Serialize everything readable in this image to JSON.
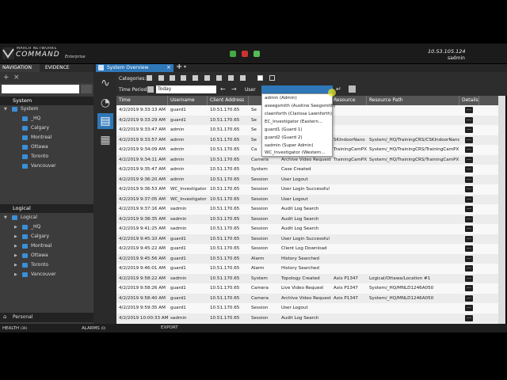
{
  "brand": {
    "line1": "MARCH NETWORKS",
    "line2": "COMMAND",
    "line3": "Enterprise"
  },
  "server": {
    "ip": "10.53.105.124",
    "user": "sadmin"
  },
  "nav": {
    "tabs": [
      "NAVIGATION",
      "EVIDENCE"
    ]
  },
  "system_tree": {
    "header": "System",
    "root": "System",
    "items": [
      "_HQ",
      "Calgary",
      "Montreal",
      "Ottawa",
      "Toronto",
      "Vancouver"
    ]
  },
  "logical_tree": {
    "header": "Logical",
    "root": "Logical",
    "items": [
      "_HQ",
      "Calgary",
      "Montreal",
      "Ottawa",
      "Toronto",
      "Vancouver"
    ]
  },
  "personal": "Personal",
  "tab": {
    "title": "System Overview"
  },
  "filters": {
    "categories_label": "Categories:",
    "time_period_label": "Time Period:",
    "time_period_value": "Today",
    "user_label": "User"
  },
  "dropdown": {
    "items": [
      "admin (Admin)",
      "aseegsmith (Austine Seegsmith)",
      "claenforth (Clarissa Lawnforth)",
      "EC_Investigator (Eastern...",
      "guard1 (Guard 1)",
      "guard2 (Guard 2)",
      "sadmin (Super Admin)",
      "WC_Investigator (Western..."
    ]
  },
  "columns": [
    "Time",
    "Username",
    "Client Address",
    "",
    "",
    "Resource",
    "Resource Path",
    "Details"
  ],
  "rows": [
    [
      "4/2/2019 9:33:13 AM",
      "guard1",
      "10.51.170.65",
      "Se",
      "",
      "",
      "",
      ""
    ],
    [
      "4/2/2019 9:33:29 AM",
      "guard1",
      "10.51.170.65",
      "Se",
      "",
      "",
      "",
      ""
    ],
    [
      "4/2/2019 9:33:47 AM",
      "admin",
      "10.51.170.65",
      "Se",
      "",
      "",
      "",
      ""
    ],
    [
      "4/2/2019 9:33:57 AM",
      "admin",
      "10.51.170.65",
      "Se",
      "",
      "SKIndoorNano",
      "System/_HQ/TrainingCRS/CSKIndoorNano",
      ""
    ],
    [
      "4/2/2019 9:34:09 AM",
      "admin",
      "10.51.170.65",
      "Ca",
      "",
      "TrainingCamPX",
      "System/_HQ/TrainingCRS/TrainingCamPX",
      ""
    ],
    [
      "4/2/2019 9:34:11 AM",
      "admin",
      "10.51.170.65",
      "Camera",
      "Archive Video Request",
      "TrainingCamPX",
      "System/_HQ/TrainingCRS/TrainingCamPX",
      ""
    ],
    [
      "4/2/2019 9:35:47 AM",
      "admin",
      "10.51.170.65",
      "System",
      "Case Created",
      "",
      "",
      ""
    ],
    [
      "4/2/2019 9:36:20 AM",
      "admin",
      "10.51.170.65",
      "Session",
      "User Logout",
      "",
      "",
      ""
    ],
    [
      "4/2/2019 9:36:53 AM",
      "WC_Investigator",
      "10.51.170.65",
      "Session",
      "User Login Successful",
      "",
      "",
      ""
    ],
    [
      "4/2/2019 9:37:05 AM",
      "WC_Investigator",
      "10.51.170.65",
      "Session",
      "User Logout",
      "",
      "",
      ""
    ],
    [
      "4/2/2019 9:37:16 AM",
      "sadmin",
      "10.51.170.65",
      "Session",
      "Audit Log Search",
      "",
      "",
      ""
    ],
    [
      "4/2/2019 9:38:35 AM",
      "sadmin",
      "10.51.170.65",
      "Session",
      "Audit Log Search",
      "",
      "",
      ""
    ],
    [
      "4/2/2019 9:41:25 AM",
      "sadmin",
      "10.51.170.65",
      "Session",
      "Audit Log Search",
      "",
      "",
      ""
    ],
    [
      "4/2/2019 9:45:10 AM",
      "guard1",
      "10.51.170.65",
      "Session",
      "User Login Successful",
      "",
      "",
      ""
    ],
    [
      "4/2/2019 9:45:22 AM",
      "guard1",
      "10.51.170.65",
      "Session",
      "Client Log Download",
      "",
      "",
      ""
    ],
    [
      "4/2/2019 9:45:56 AM",
      "guard1",
      "10.51.170.65",
      "Alarm",
      "History Searched",
      "",
      "",
      ""
    ],
    [
      "4/2/2019 9:46:01 AM",
      "guard1",
      "10.51.170.65",
      "Alarm",
      "History Searched",
      "",
      "",
      ""
    ],
    [
      "4/2/2019 9:58:22 AM",
      "sadmin",
      "10.51.170.65",
      "System",
      "Topology Created",
      "Axis P1347",
      "Logical/Ottawa/Location #1",
      ""
    ],
    [
      "4/2/2019 9:58:26 AM",
      "guard1",
      "10.51.170.65",
      "Camera",
      "Live Video Request",
      "Axis P1347",
      "System/_HQ/MNLD1246A050",
      ""
    ],
    [
      "4/2/2019 9:58:40 AM",
      "guard1",
      "10.51.170.65",
      "Camera",
      "Archive Video Request",
      "Axis P1347",
      "System/_HQ/MNLD1246A050",
      ""
    ],
    [
      "4/2/2019 9:59:35 AM",
      "guard1",
      "10.51.170.65",
      "Session",
      "User Logout",
      "",
      "",
      ""
    ],
    [
      "4/2/2019 10:00:33 AM",
      "sadmin",
      "10.51.170.65",
      "Session",
      "Audit Log Search",
      "",
      "",
      ""
    ]
  ],
  "details_label": "...",
  "bottom": {
    "health": "HEALTH",
    "health_count": "(39)",
    "alarms": "ALARMS",
    "alarms_count": "(0)",
    "export": "EXPORT"
  }
}
